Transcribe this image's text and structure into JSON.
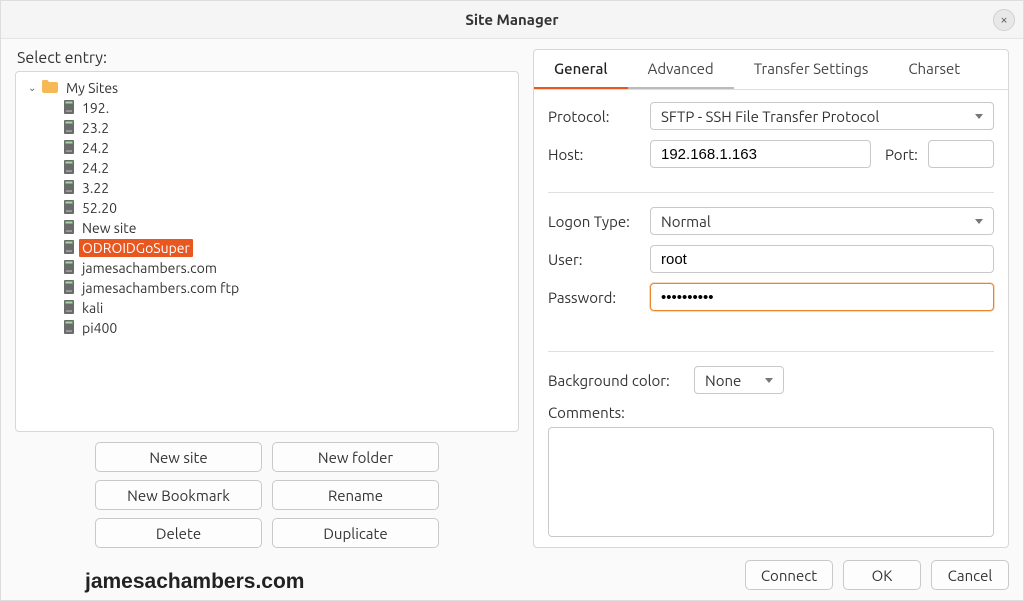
{
  "window": {
    "title": "Site Manager"
  },
  "left": {
    "select_label": "Select entry:",
    "root_folder": "My Sites",
    "sites": [
      {
        "label": "192.",
        "selected": false
      },
      {
        "label": "23.2",
        "selected": false
      },
      {
        "label": "24.2",
        "selected": false
      },
      {
        "label": "24.2",
        "selected": false
      },
      {
        "label": "3.22",
        "selected": false
      },
      {
        "label": "52.20",
        "selected": false
      },
      {
        "label": "New site",
        "selected": false
      },
      {
        "label": "ODROIDGoSuper",
        "selected": true
      },
      {
        "label": "jamesachambers.com",
        "selected": false
      },
      {
        "label": "jamesachambers.com ftp",
        "selected": false
      },
      {
        "label": "kali",
        "selected": false
      },
      {
        "label": "pi400",
        "selected": false
      }
    ],
    "buttons": {
      "new_site": "New site",
      "new_folder": "New folder",
      "new_bookmark": "New Bookmark",
      "rename": "Rename",
      "delete": "Delete",
      "duplicate": "Duplicate"
    }
  },
  "tabs": {
    "general": "General",
    "advanced": "Advanced",
    "transfer": "Transfer Settings",
    "charset": "Charset"
  },
  "form": {
    "protocol_label": "Protocol:",
    "protocol_value": "SFTP - SSH File Transfer Protocol",
    "host_label": "Host:",
    "host_value": "192.168.1.163",
    "port_label": "Port:",
    "port_value": "",
    "logon_label": "Logon Type:",
    "logon_value": "Normal",
    "user_label": "User:",
    "user_value": "root",
    "password_label": "Password:",
    "password_value": "••••••••••",
    "bgcolor_label": "Background color:",
    "bgcolor_value": "None",
    "comments_label": "Comments:"
  },
  "footer": {
    "connect": "Connect",
    "ok": "OK",
    "cancel": "Cancel"
  },
  "watermark": "jamesachambers.com"
}
